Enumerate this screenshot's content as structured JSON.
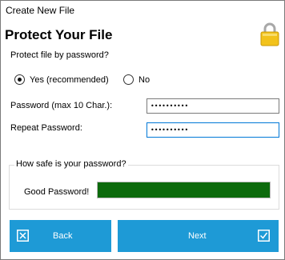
{
  "window": {
    "title": "Create New File"
  },
  "header": {
    "heading": "Protect Your File",
    "icon": "padlock-icon"
  },
  "protection": {
    "question": "Protect file by password?",
    "options": [
      {
        "label": "Yes (recommended)",
        "selected": true
      },
      {
        "label": "No",
        "selected": false
      }
    ]
  },
  "fields": {
    "password_label": "Password (max 10 Char.):",
    "password_value": "••••••••••",
    "repeat_label": "Repeat Password:",
    "repeat_value": "••••••••••"
  },
  "strength": {
    "group_title": "How safe is your password?",
    "label": "Good Password!",
    "level": 1.0,
    "color": "#0c6a0c"
  },
  "buttons": {
    "back_label": "Back",
    "back_icon": "close-box-icon",
    "next_label": "Next",
    "next_icon": "checkbox-checked-icon",
    "color": "#1e9ad6"
  }
}
